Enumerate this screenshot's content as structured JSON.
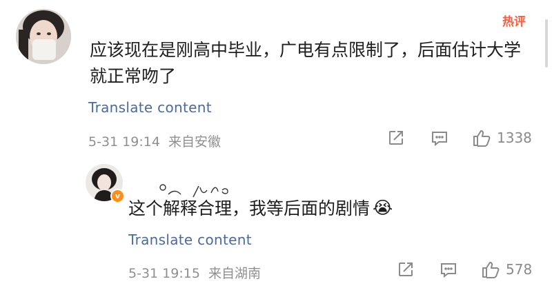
{
  "main_comment": {
    "hot_label": "热评",
    "text": "应该现在是刚高中毕业，广电有点限制了，后面估计大学就正常吻了",
    "translate_label": "Translate content",
    "timestamp": "5-31 19:14",
    "location": "来自安徽",
    "like_count": "1338"
  },
  "reply": {
    "text": "这个解释合理，我等后面的剧情",
    "emoji": "😭",
    "translate_label": "Translate content",
    "timestamp": "5-31 19:15",
    "location": "来自湖南",
    "like_count": "578",
    "vip_badge": "v"
  },
  "colors": {
    "hot": "#ff5b3a",
    "translate_link": "#4a6a9c",
    "meta_text": "#8f8f8f",
    "vip_badge": "#ff8d1a"
  },
  "icons": [
    "share-icon",
    "comment-icon",
    "like-icon"
  ]
}
